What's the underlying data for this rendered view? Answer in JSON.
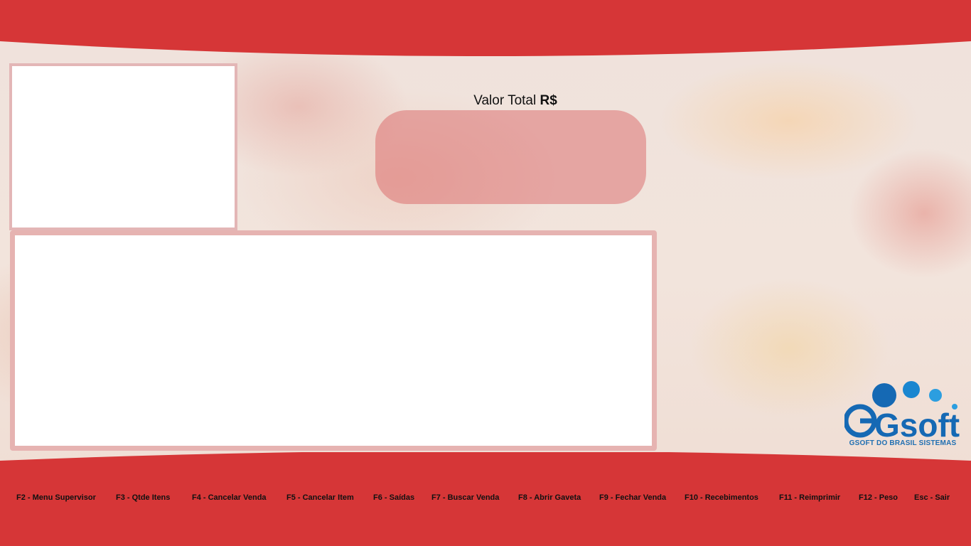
{
  "total": {
    "label_prefix": "Valor Total",
    "currency": "R$",
    "value": ""
  },
  "logo": {
    "text": "Gsoft",
    "subtitle": "GSOFT DO BRASIL SISTEMAS"
  },
  "function_keys": [
    {
      "label": "F2 - Menu Supervisor"
    },
    {
      "label": "F3 - Qtde Itens"
    },
    {
      "label": "F4 - Cancelar Venda"
    },
    {
      "label": "F5 - Cancelar Item"
    },
    {
      "label": "F6 - Saídas"
    },
    {
      "label": "F7 - Buscar Venda"
    },
    {
      "label": "F8 - Abrir Gaveta"
    },
    {
      "label": "F9 - Fechar Venda"
    },
    {
      "label": "F10 - Recebimentos"
    },
    {
      "label": "F11 - Reimprimir"
    },
    {
      "label": "F12 - Peso"
    },
    {
      "label": "Esc - Sair"
    }
  ],
  "colors": {
    "band_red": "#d63637",
    "panel_border": "#e6b3b1",
    "logo_blue": "#1f6fb2"
  }
}
